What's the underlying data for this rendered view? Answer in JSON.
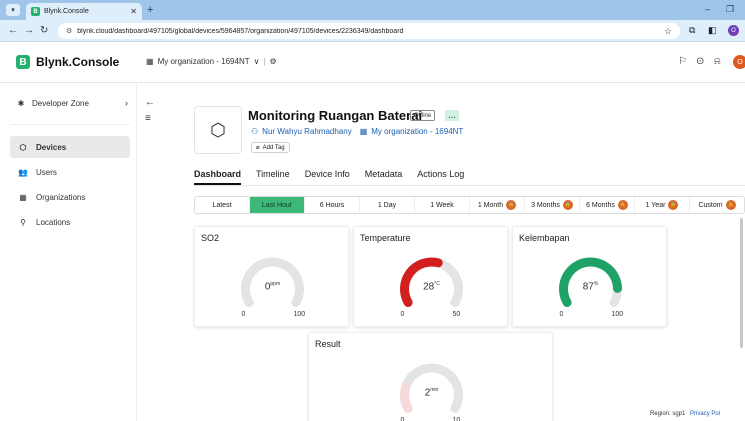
{
  "browser": {
    "tab_title": "Blynk.Console",
    "tab_favicon": "B",
    "new_tab_label": "+",
    "url": "blynk.cloud/dashboard/497105/global/devices/5964857/organization/497105/devices/2236349/dashboard",
    "profile_initial": "O"
  },
  "app": {
    "logo_letter": "B",
    "logo_text": "Blynk.Console",
    "org_name": "My organization - 1694NT",
    "org_chevron": "∨",
    "avatar_initial": "O",
    "accent_color": "#23b26d"
  },
  "sidebar": {
    "developer_zone": "Developer Zone",
    "items": [
      {
        "label": "Devices",
        "icon": "chip-icon",
        "active": true
      },
      {
        "label": "Users",
        "icon": "users-icon",
        "active": false
      },
      {
        "label": "Organizations",
        "icon": "building-icon",
        "active": false
      },
      {
        "label": "Locations",
        "icon": "pin-icon",
        "active": false
      }
    ]
  },
  "device": {
    "name": "Monitoring Ruangan Baterai",
    "status": "Offline",
    "owner": "Nur Wahyu Rahmadhany",
    "organization": "My organization - 1694NT",
    "add_tag": "Add Tag",
    "more_label": "…"
  },
  "tabs": [
    "Dashboard",
    "Timeline",
    "Device Info",
    "Metadata",
    "Actions Log"
  ],
  "active_tab": "Dashboard",
  "time_ranges": [
    {
      "label": "Latest",
      "locked": false,
      "active": false
    },
    {
      "label": "Last Hour",
      "locked": false,
      "active": true
    },
    {
      "label": "6 Hours",
      "locked": false,
      "active": false
    },
    {
      "label": "1 Day",
      "locked": false,
      "active": false
    },
    {
      "label": "1 Week",
      "locked": false,
      "active": false
    },
    {
      "label": "1 Month",
      "locked": true,
      "active": false
    },
    {
      "label": "3 Months",
      "locked": true,
      "active": false
    },
    {
      "label": "6 Months",
      "locked": true,
      "active": false
    },
    {
      "label": "1 Year",
      "locked": true,
      "active": false
    },
    {
      "label": "Custom",
      "locked": true,
      "active": false
    }
  ],
  "widgets": [
    {
      "title": "SO2",
      "value": "0",
      "unit": "ppm",
      "min": "0",
      "max": "100",
      "fraction": 0.0,
      "color": "#d0d0d0"
    },
    {
      "title": "Temperature",
      "value": "28",
      "unit": "°C",
      "min": "0",
      "max": "50",
      "fraction": 0.56,
      "color": "#d21f1f"
    },
    {
      "title": "Kelembapan",
      "value": "87",
      "unit": "%",
      "min": "0",
      "max": "100",
      "fraction": 0.87,
      "color": "#1fa267"
    },
    {
      "title": "Result",
      "value": "2",
      "unit": "min",
      "min": "0",
      "max": "10",
      "fraction": 0.2,
      "color": "#f6d9d9"
    }
  ],
  "footer": {
    "region": "Region: sgp1",
    "privacy": "Privacy Pol"
  }
}
